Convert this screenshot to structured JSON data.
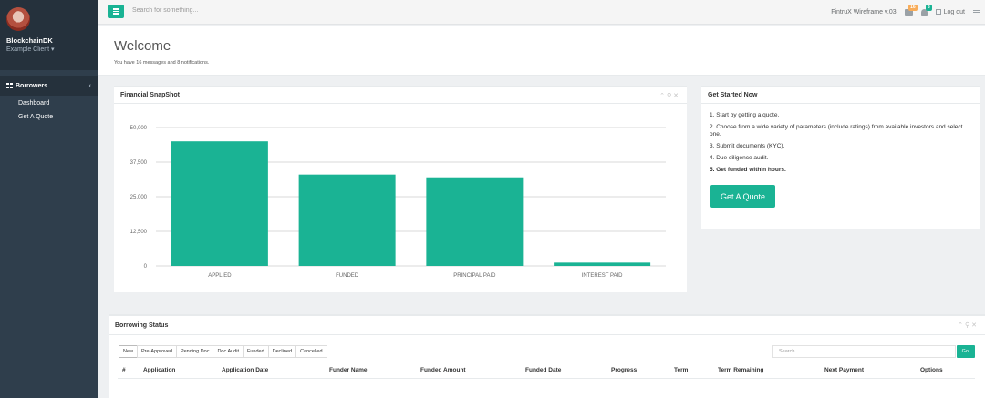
{
  "user": {
    "name": "BlockchainDK",
    "role": "Example Client ▾"
  },
  "sidebar": {
    "section_label": "Borrowers",
    "items": [
      {
        "label": "Dashboard"
      },
      {
        "label": "Get A Quote"
      }
    ]
  },
  "topbar": {
    "search_placeholder": "Search for something...",
    "app_version": "FintruX Wireframe v.03",
    "messages_badge": "16",
    "notifications_badge": "8",
    "logout_label": "Log out"
  },
  "welcome": {
    "title": "Welcome",
    "subtitle": "You have 16 messages and 8 notifications."
  },
  "snapshot": {
    "title": "Financial SnapShot"
  },
  "chart_data": {
    "type": "bar",
    "categories": [
      "APPLIED",
      "FUNDED",
      "PRINCIPAL PAID",
      "INTEREST PAID"
    ],
    "values": [
      45000,
      33000,
      32000,
      1200
    ],
    "ylim": [
      0,
      50000
    ],
    "yticks": [
      "0",
      "12,500",
      "25,000",
      "37,500",
      "50,000"
    ],
    "ytick_values": [
      0,
      12500,
      25000,
      37500,
      50000
    ],
    "bar_color": "#1ab394",
    "grid": true
  },
  "get_started": {
    "title": "Get Started Now",
    "steps": [
      "1. Start by getting a quote.",
      "2. Choose from a wide variety of parameters (include ratings) from available investors and select one.",
      "3. Submit documents (KYC).",
      "4. Due diligence audit.",
      "5. Get funded within hours."
    ],
    "button_label": "Get A Quote"
  },
  "borrowing": {
    "title": "Borrowing Status",
    "tabs": [
      "New",
      "Pre-Approved",
      "Pending Doc",
      "Doc Audit",
      "Funded",
      "Declined",
      "Cancelled"
    ],
    "search_placeholder": "Search",
    "go_label": "Go!",
    "columns": [
      "#",
      "Application",
      "Application Date",
      "Funder Name",
      "Funded Amount",
      "Funded Date",
      "Progress",
      "Term",
      "Term Remaining",
      "Next Payment",
      "Options"
    ]
  },
  "colors": {
    "accent": "#1ab394",
    "sidebar": "#2f3e4c",
    "badge_orange": "#f8ac59"
  },
  "icons": {
    "tools": "chevron-up, wrench, close"
  }
}
